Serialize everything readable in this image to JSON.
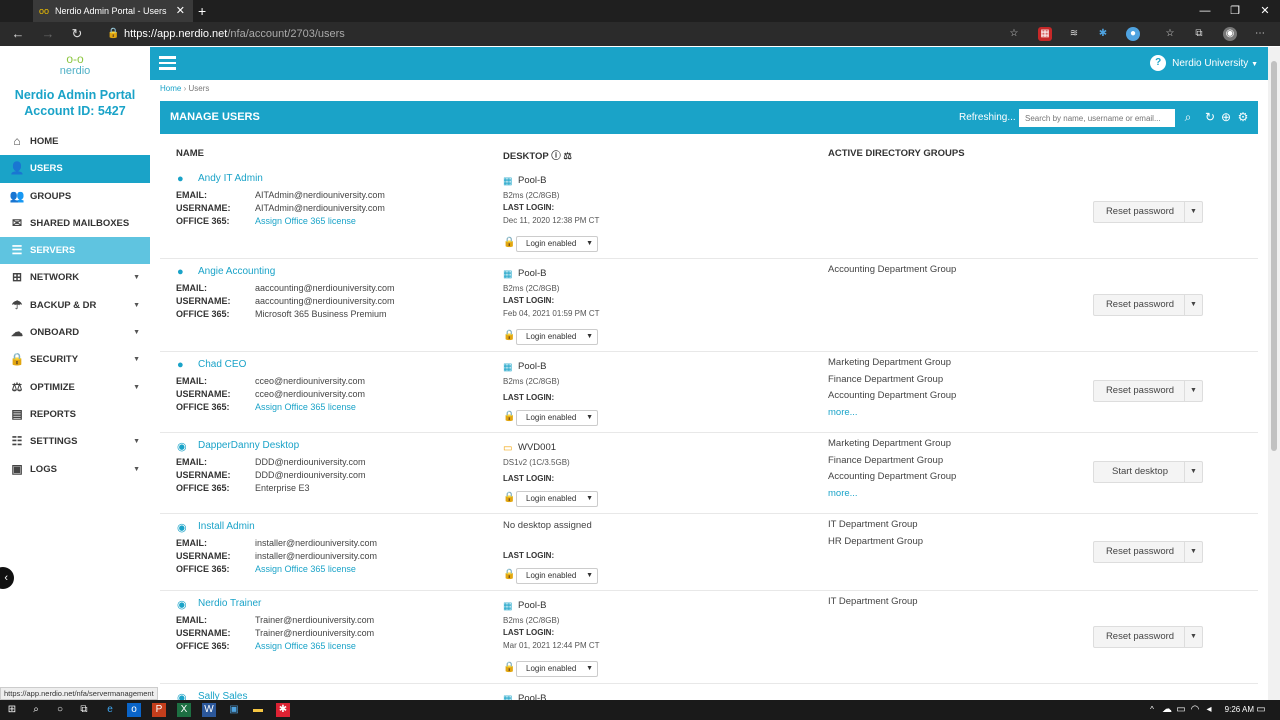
{
  "browser": {
    "tab_title": "Nerdio Admin Portal - Users",
    "url_host": "https://app.nerdio.net",
    "url_path": "/nfa/account/2703/users",
    "status_url": "https://app.nerdio.net/nfa/servermanagement"
  },
  "sidebar": {
    "logo_text": "nerdio",
    "portal_title": "Nerdio Admin Portal",
    "account_id": "Account ID: 5427",
    "items": [
      {
        "label": "HOME",
        "icon": "home-icon",
        "glyph": "⌂",
        "caret": false
      },
      {
        "label": "USERS",
        "icon": "user-icon",
        "glyph": "👤",
        "caret": false
      },
      {
        "label": "GROUPS",
        "icon": "groups-icon",
        "glyph": "👥",
        "caret": false
      },
      {
        "label": "SHARED MAILBOXES",
        "icon": "mailbox-icon",
        "glyph": "✉",
        "caret": false
      },
      {
        "label": "SERVERS",
        "icon": "servers-icon",
        "glyph": "☰",
        "caret": false
      },
      {
        "label": "NETWORK",
        "icon": "network-icon",
        "glyph": "⊞",
        "caret": true
      },
      {
        "label": "BACKUP & DR",
        "icon": "umbrella-icon",
        "glyph": "☂",
        "caret": true
      },
      {
        "label": "ONBOARD",
        "icon": "cloud-upload-icon",
        "glyph": "☁",
        "caret": true
      },
      {
        "label": "SECURITY",
        "icon": "lock-icon",
        "glyph": "🔒",
        "caret": true
      },
      {
        "label": "OPTIMIZE",
        "icon": "scale-icon",
        "glyph": "⚖",
        "caret": true
      },
      {
        "label": "REPORTS",
        "icon": "reports-icon",
        "glyph": "▤",
        "caret": false
      },
      {
        "label": "SETTINGS",
        "icon": "sliders-icon",
        "glyph": "☷",
        "caret": true
      },
      {
        "label": "LOGS",
        "icon": "logs-icon",
        "glyph": "▣",
        "caret": true
      }
    ]
  },
  "topbar": {
    "university": "Nerdio University",
    "help": "?"
  },
  "breadcrumb": {
    "home": "Home",
    "sep": "›",
    "current": "Users"
  },
  "panel": {
    "title": "MANAGE USERS",
    "refreshing": "Refreshing...",
    "search_placeholder": "Search by name, username or email..."
  },
  "columns": {
    "name": "NAME",
    "desktop": "DESKTOP",
    "groups": "ACTIVE DIRECTORY GROUPS"
  },
  "labels": {
    "email": "EMAIL:",
    "username": "USERNAME:",
    "office": "OFFICE 365:",
    "last_login": "LAST LOGIN:",
    "login_enabled": "Login enabled"
  },
  "users": [
    {
      "name": "Andy IT Admin",
      "email": "AITAdmin@nerdiouniversity.com",
      "username": "AITAdmin@nerdiouniversity.com",
      "office": "Assign Office 365 license",
      "office_link": true,
      "desktop": "Pool-B",
      "desktop_type": "pool",
      "spec": "B2ms (2C/8GB)",
      "last_login": "Dec 11, 2020 12:38 PM CT",
      "groups": [],
      "more": false,
      "action": "Reset password"
    },
    {
      "name": "Angie Accounting",
      "email": "aaccounting@nerdiouniversity.com",
      "username": "aaccounting@nerdiouniversity.com",
      "office": "Microsoft 365 Business Premium",
      "office_link": false,
      "desktop": "Pool-B",
      "desktop_type": "pool",
      "spec": "B2ms (2C/8GB)",
      "last_login": "Feb 04, 2021 01:59 PM CT",
      "groups": [
        "Accounting Department Group"
      ],
      "more": false,
      "action": "Reset password"
    },
    {
      "name": "Chad CEO",
      "email": "cceo@nerdiouniversity.com",
      "username": "cceo@nerdiouniversity.com",
      "office": "Assign Office 365 license",
      "office_link": true,
      "desktop": "Pool-B",
      "desktop_type": "pool",
      "spec": "B2ms (2C/8GB)",
      "last_login": "",
      "groups": [
        "Marketing Department Group",
        "Finance Department Group",
        "Accounting Department Group"
      ],
      "more": true,
      "action": "Reset password"
    },
    {
      "name": "DapperDanny Desktop",
      "email": "DDD@nerdiouniversity.com",
      "username": "DDD@nerdiouniversity.com",
      "office": "Enterprise E3",
      "office_link": false,
      "desktop": "WVD001",
      "desktop_type": "vm",
      "spec": "DS1v2 (1C/3.5GB)",
      "last_login": "",
      "groups": [
        "Marketing Department Group",
        "Finance Department Group",
        "Accounting Department Group"
      ],
      "more": true,
      "action": "Start desktop"
    },
    {
      "name": "Install Admin",
      "email": "installer@nerdiouniversity.com",
      "username": "installer@nerdiouniversity.com",
      "office": "Assign Office 365 license",
      "office_link": true,
      "desktop": "No desktop assigned",
      "desktop_type": "none",
      "spec": "",
      "last_login": "",
      "groups": [
        "IT Department Group",
        "HR Department Group"
      ],
      "more": false,
      "action": "Reset password"
    },
    {
      "name": "Nerdio Trainer",
      "email": "Trainer@nerdiouniversity.com",
      "username": "Trainer@nerdiouniversity.com",
      "office": "Assign Office 365 license",
      "office_link": true,
      "desktop": "Pool-B",
      "desktop_type": "pool",
      "spec": "B2ms (2C/8GB)",
      "last_login": "Mar 01, 2021 12:44 PM CT",
      "groups": [
        "IT Department Group"
      ],
      "more": false,
      "action": "Reset password"
    },
    {
      "name": "Sally Sales",
      "desktop": "Pool-B"
    }
  ],
  "more_label": "more...",
  "clock": "9:26 AM"
}
